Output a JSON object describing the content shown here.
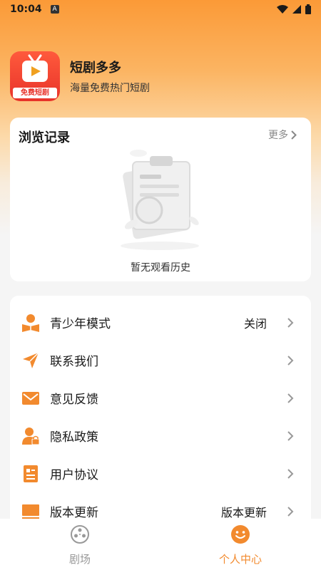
{
  "status_bar": {
    "time": "10:04",
    "indicator": "A"
  },
  "app": {
    "name": "短剧多多",
    "subtitle": "海量免费热门短剧",
    "logo_tag": "免费短剧",
    "brand_color": "#f28a2e"
  },
  "history": {
    "title": "浏览记录",
    "more_label": "更多",
    "empty_text": "暂无观看历史"
  },
  "menu": {
    "items": [
      {
        "label": "青少年模式",
        "value": "关闭",
        "icon": "youth-mode-icon"
      },
      {
        "label": "联系我们",
        "value": "",
        "icon": "send-icon"
      },
      {
        "label": "意见反馈",
        "value": "",
        "icon": "mail-icon"
      },
      {
        "label": "隐私政策",
        "value": "",
        "icon": "privacy-user-lock-icon"
      },
      {
        "label": "用户协议",
        "value": "",
        "icon": "document-icon"
      },
      {
        "label": "版本更新",
        "value": "版本更新",
        "icon": "monitor-icon"
      }
    ]
  },
  "tabbar": {
    "tabs": [
      {
        "label": "剧场",
        "active": false,
        "icon": "film-reel-icon"
      },
      {
        "label": "个人中心",
        "active": true,
        "icon": "smiley-face-icon"
      }
    ],
    "active_color": "#f28a2e",
    "inactive_color": "#999999"
  }
}
